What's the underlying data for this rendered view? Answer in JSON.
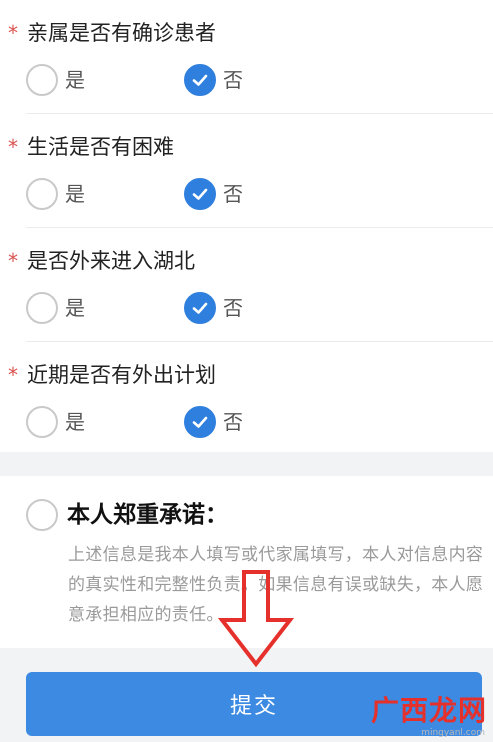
{
  "questions": [
    {
      "title": "亲属是否有确诊患者",
      "required_mark": "*",
      "options": [
        {
          "label": "是",
          "checked": false
        },
        {
          "label": "否",
          "checked": true
        }
      ]
    },
    {
      "title": "生活是否有困难",
      "required_mark": "*",
      "options": [
        {
          "label": "是",
          "checked": false
        },
        {
          "label": "否",
          "checked": true
        }
      ]
    },
    {
      "title": "是否外来进入湖北",
      "required_mark": "*",
      "options": [
        {
          "label": "是",
          "checked": false
        },
        {
          "label": "否",
          "checked": true
        }
      ]
    },
    {
      "title": "近期是否有外出计划",
      "required_mark": "*",
      "options": [
        {
          "label": "是",
          "checked": false
        },
        {
          "label": "否",
          "checked": true
        }
      ]
    }
  ],
  "promise": {
    "title": "本人郑重承诺：",
    "text": "上述信息是我本人填写或代家属填写，本人对信息内容的真实性和完整性负责。如果信息有误或缺失，本人愿意承担相应的责任。",
    "checked": false
  },
  "submit_label": "提交",
  "watermark": {
    "text": "广西龙网",
    "url": "mingyanl.com"
  },
  "colors": {
    "accent": "#2f7fde",
    "button": "#3d8ae3",
    "required": "#d9534f",
    "arrow": "#e5302b"
  }
}
